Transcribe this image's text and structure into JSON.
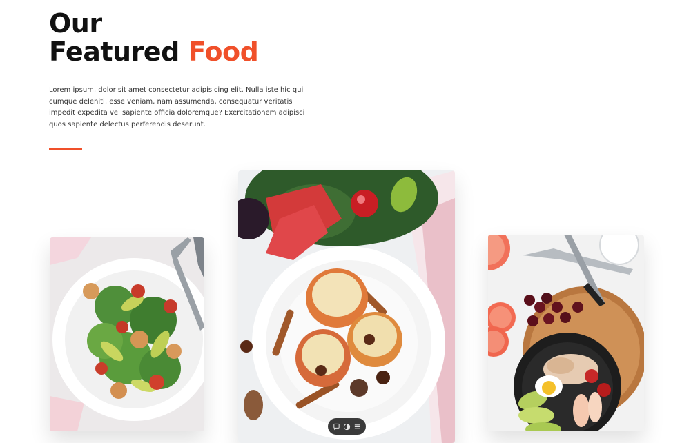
{
  "section": {
    "title_line1": "Our",
    "title_line2_prefix": "Featured ",
    "title_line2_accent": "Food",
    "description": "Lorem ipsum, dolor sit amet consectetur adipisicing elit. Nulla iste hic qui cumque deleniti, esse veniam, nam assumenda, consequatur veritatis impedit expedita vel sapiente officia doloremque? Exercitationem adipisci quos sapiente delectus perferendis deserunt."
  },
  "colors": {
    "accent": "#f0502a",
    "heading": "#111111",
    "text": "#333333",
    "background": "#ffffff"
  },
  "cards": [
    {
      "subject": "salad with shrimp, avocado, tomatoes and greens on white plate with fork"
    },
    {
      "subject": "baked stuffed apples with cinnamon sticks and star anise, christmas decoration"
    },
    {
      "subject": "poke bowl with salmon, avocado, egg, grapefruit and cherries"
    }
  ],
  "toolbar": {
    "icons": [
      "comment-icon",
      "contrast-icon",
      "menu-icon"
    ]
  }
}
